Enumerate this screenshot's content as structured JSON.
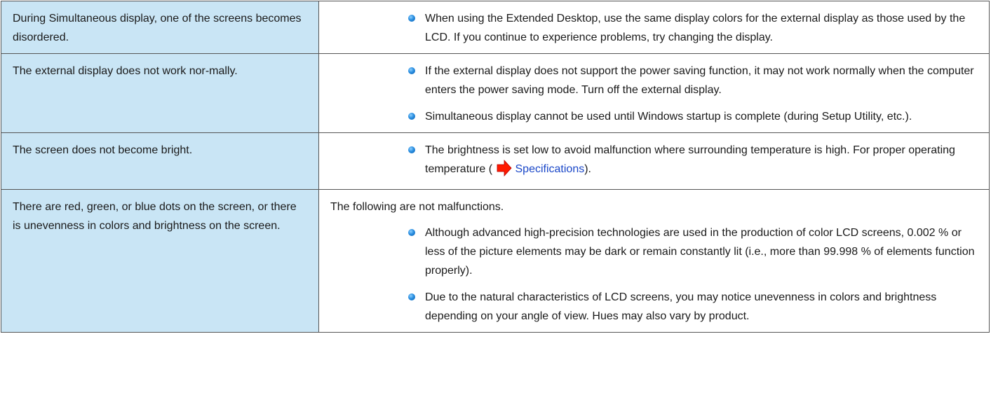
{
  "rows": [
    {
      "problem": "During Simultaneous display, one of the screens becomes disordered.",
      "solutions": [
        "When using the Extended Desktop, use the same display colors for the external display as those used by the LCD. If you continue to experience problems, try changing the display."
      ]
    },
    {
      "problem": "The external display does not work nor-mally.",
      "solutions": [
        "If the external display does not support the power saving function, it may not work normally when the computer enters the power saving mode. Turn off the external display.",
        "Simultaneous display cannot be used until Windows startup is complete (during Setup Utility, etc.)."
      ]
    },
    {
      "problem": "The screen does not become bright.",
      "solution_text_before": "The brightness is set low to avoid malfunction where surrounding temperature is high. For proper operating temperature (",
      "link_text": "Specifications",
      "solution_text_after": ")."
    },
    {
      "problem": "There are red, green, or blue dots on the screen, or there is unevenness in colors and brightness on the screen.",
      "intro": "The following are not malfunctions.",
      "solutions": [
        "Although advanced high-precision technologies are used in the production of color LCD screens, 0.002 % or less of the picture elements may be dark or remain constantly lit (i.e., more than 99.998 % of elements function properly).",
        "Due to the natural characteristics of LCD screens, you may notice unevenness in colors and brightness depending on your angle of view. Hues may also vary by product."
      ]
    }
  ],
  "icons": {
    "bullet": "blue-dot-bullet-icon",
    "link_arrow": "red-arrow-icon"
  },
  "colors": {
    "problem_cell_bg": "#c9e5f5",
    "border": "#555555",
    "link": "#1a47c8",
    "arrow": "#ff0000",
    "bullet": "#2a8ee0"
  }
}
